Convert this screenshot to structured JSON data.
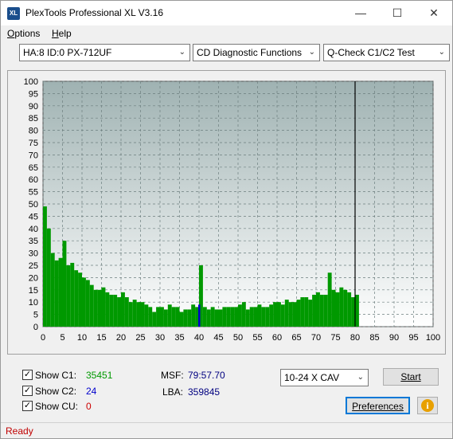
{
  "window": {
    "title": "PlexTools Professional XL V3.16",
    "app_icon_text": "XL",
    "minimize_glyph": "—",
    "maximize_glyph": "☐",
    "close_glyph": "✕"
  },
  "menu": {
    "options": "Options",
    "options_accel": "O",
    "options_rest": "ptions",
    "help_accel": "H",
    "help_rest": "elp"
  },
  "toolbar": {
    "drive": "HA:8 ID:0  PX-712UF",
    "function": "CD Diagnostic Functions",
    "test": "Q-Check C1/C2 Test",
    "arrow_glyph": "⌄"
  },
  "chart_data": {
    "type": "bar",
    "xlim": [
      0,
      100
    ],
    "ylim": [
      0,
      100
    ],
    "x_ticks": [
      0,
      5,
      10,
      15,
      20,
      25,
      30,
      35,
      40,
      45,
      50,
      55,
      60,
      65,
      70,
      75,
      80,
      85,
      90,
      95,
      100
    ],
    "y_ticks": [
      0,
      5,
      10,
      15,
      20,
      25,
      30,
      35,
      40,
      45,
      50,
      55,
      60,
      65,
      70,
      75,
      80,
      85,
      90,
      95,
      100
    ],
    "grid": true,
    "end_marker_x": 80,
    "colors": {
      "c1": "#009900",
      "c2": "#0000cc",
      "end_marker": "#000000",
      "plot_bg_top": "#9fb2b2",
      "plot_bg_bottom": "#ffffff"
    },
    "series": [
      {
        "name": "C1",
        "x": [
          0,
          1,
          2,
          3,
          4,
          5,
          6,
          7,
          8,
          9,
          10,
          11,
          12,
          13,
          14,
          15,
          16,
          17,
          18,
          19,
          20,
          21,
          22,
          23,
          24,
          25,
          26,
          27,
          28,
          29,
          30,
          31,
          32,
          33,
          34,
          35,
          36,
          37,
          38,
          39,
          40,
          41,
          42,
          43,
          44,
          45,
          46,
          47,
          48,
          49,
          50,
          51,
          52,
          53,
          54,
          55,
          56,
          57,
          58,
          59,
          60,
          61,
          62,
          63,
          64,
          65,
          66,
          67,
          68,
          69,
          70,
          71,
          72,
          73,
          74,
          75,
          76,
          77,
          78,
          79,
          80
        ],
        "values": [
          49,
          40,
          30,
          27,
          28,
          35,
          25,
          26,
          23,
          22,
          20,
          19,
          17,
          15,
          15,
          16,
          14,
          13,
          13,
          12,
          14,
          12,
          10,
          11,
          10,
          10,
          9,
          8,
          6,
          8,
          8,
          7,
          9,
          8,
          8,
          6,
          7,
          7,
          9,
          8,
          25,
          8,
          7,
          8,
          7,
          7,
          8,
          8,
          8,
          8,
          9,
          10,
          7,
          8,
          8,
          9,
          8,
          8,
          9,
          10,
          10,
          9,
          11,
          10,
          10,
          11,
          12,
          12,
          11,
          13,
          14,
          13,
          13,
          22,
          15,
          14,
          16,
          15,
          14,
          12,
          13
        ]
      },
      {
        "name": "C2",
        "x": [
          40
        ],
        "values": [
          9
        ]
      }
    ]
  },
  "stats": {
    "show_c1_label": "Show C1:",
    "show_c1_value": "35451",
    "show_c2_label": "Show C2:",
    "show_c2_value": "24",
    "show_cu_label": "Show CU:",
    "show_cu_value": "0",
    "msf_label": "MSF:",
    "msf_value": "79:57.70",
    "lba_label": "LBA:",
    "lba_value": "359845",
    "check_glyph": "✓",
    "c1_color": "#009900",
    "c2_color": "#0000cc",
    "cu_color": "#cc0000"
  },
  "controls": {
    "speed": "10-24 X CAV",
    "start": "Start",
    "preferences": "Preferences",
    "info_icon_glyph": "i"
  },
  "status": {
    "text": "Ready"
  }
}
